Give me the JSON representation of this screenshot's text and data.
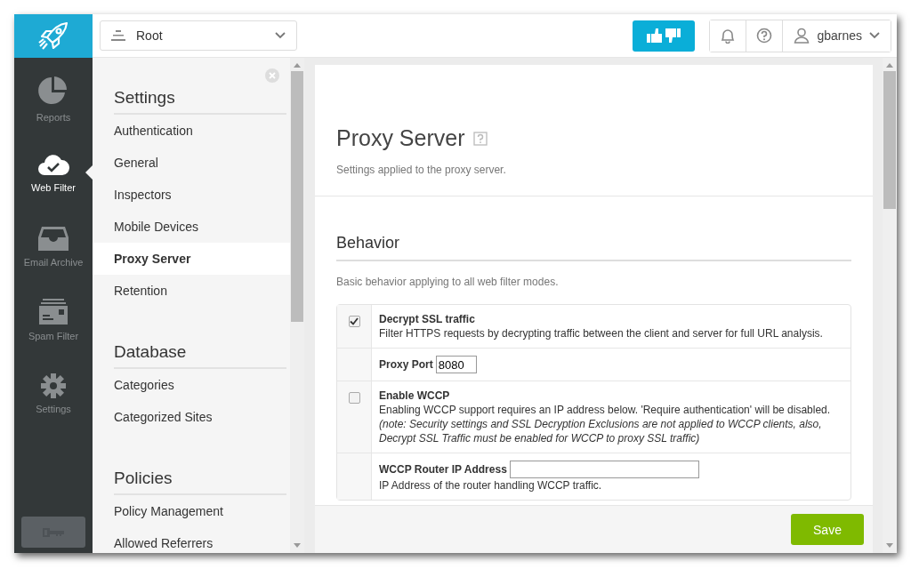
{
  "root_selector": {
    "label": "Root"
  },
  "user": {
    "name": "gbarnes"
  },
  "rail": [
    {
      "kind": "reports",
      "label": "Reports",
      "selected": false
    },
    {
      "kind": "webfilter",
      "label": "Web Filter",
      "selected": true
    },
    {
      "kind": "archive",
      "label": "Email Archive",
      "selected": false
    },
    {
      "kind": "spam",
      "label": "Spam Filter",
      "selected": false
    },
    {
      "kind": "settings",
      "label": "Settings",
      "selected": false
    }
  ],
  "nav_sections": [
    {
      "title": "Settings",
      "items": [
        {
          "label": "Authentication",
          "selected": false
        },
        {
          "label": "General",
          "selected": false
        },
        {
          "label": "Inspectors",
          "selected": false
        },
        {
          "label": "Mobile Devices",
          "selected": false
        },
        {
          "label": "Proxy Server",
          "selected": true
        },
        {
          "label": "Retention",
          "selected": false
        }
      ]
    },
    {
      "title": "Database",
      "items": [
        {
          "label": "Categories",
          "selected": false
        },
        {
          "label": "Categorized Sites",
          "selected": false
        }
      ]
    },
    {
      "title": "Policies",
      "items": [
        {
          "label": "Policy Management",
          "selected": false
        },
        {
          "label": "Allowed Referrers",
          "selected": false
        }
      ]
    }
  ],
  "page": {
    "title": "Proxy Server",
    "subtitle": "Settings applied to the proxy server.",
    "section_title": "Behavior",
    "section_description": "Basic behavior applying to all web filter modes.",
    "options": [
      {
        "kind": "checkbox",
        "label": "Decrypt SSL traffic",
        "checked": true,
        "description": "Filter HTTPS requests by decrypting traffic between the client and server for full URL analysis."
      },
      {
        "kind": "field",
        "label": "Proxy Port",
        "value": "8080"
      },
      {
        "kind": "checkbox",
        "label": "Enable WCCP",
        "checked": false,
        "description": "Enabling WCCP support requires an IP address below. 'Require authentication' will be disabled.",
        "note": "(note: Security settings and SSL Decryption Exclusions are not applied to WCCP clients, also, Decrypt SSL Traffic must be enabled for WCCP to proxy SSL traffic)"
      },
      {
        "kind": "field",
        "label": "WCCP Router IP Address",
        "description": "IP Address of the router handling WCCP traffic."
      }
    ]
  },
  "save_button": "Save"
}
